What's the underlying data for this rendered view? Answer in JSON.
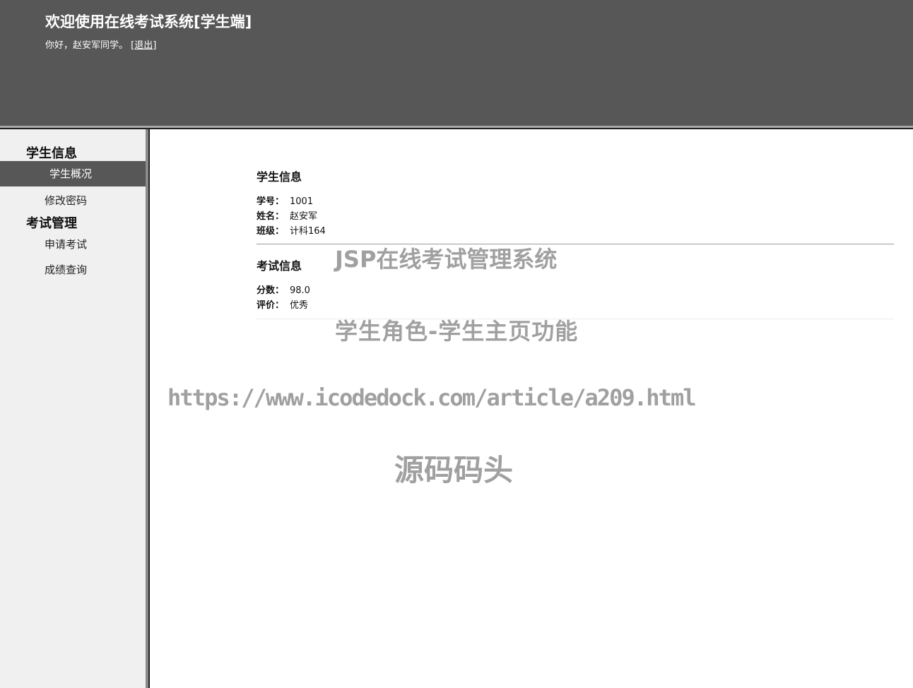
{
  "header": {
    "title": "欢迎使用在线考试系统[学生端]",
    "greeting_prefix": "你好，赵安军同学。 [",
    "logout_label": "退出",
    "greeting_suffix": "]"
  },
  "sidebar": {
    "sections": [
      {
        "title": "学生信息",
        "items": [
          {
            "label": "学生概况",
            "active": true
          },
          {
            "label": "修改密码",
            "active": false
          }
        ]
      },
      {
        "title": "考试管理",
        "items": [
          {
            "label": "申请考试",
            "active": false
          },
          {
            "label": "成绩查询",
            "active": false
          }
        ]
      }
    ]
  },
  "main": {
    "student_info": {
      "heading": "学生信息",
      "rows": [
        {
          "label": "学号：",
          "value": "1001"
        },
        {
          "label": "姓名：",
          "value": "赵安军"
        },
        {
          "label": "班级：",
          "value": "计科164"
        }
      ]
    },
    "exam_info": {
      "heading": "考试信息",
      "rows": [
        {
          "label": "分数：",
          "value": "98.0"
        },
        {
          "label": "评价：",
          "value": "优秀"
        }
      ]
    }
  },
  "watermarks": {
    "line1": "JSP在线考试管理系统",
    "line2": "学生角色-学生主页功能",
    "line3": "https://www.icodedock.com/article/a209.html",
    "line4": "源码码头"
  },
  "colors": {
    "header_bg": "#575757",
    "sidebar_bg": "#f0f0f0",
    "active_item_bg": "#575757",
    "watermark": "#a0a0a0"
  }
}
